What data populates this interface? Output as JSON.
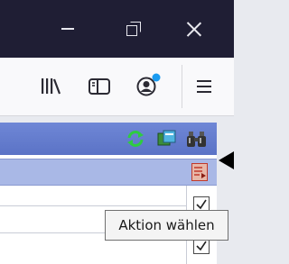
{
  "window_controls": {
    "minimize": "minimize",
    "maximize": "restore",
    "close": "close"
  },
  "toolbar": {
    "icons": [
      "library-icon",
      "sidebar-icon",
      "account-icon",
      "menu-icon"
    ],
    "account_badge_color": "#1a9bf0"
  },
  "panel": {
    "header_color": "#6f87d6",
    "header_icons": [
      "refresh-icon",
      "new-window-icon",
      "binoculars-icon"
    ],
    "action_button_color": "#c0392b",
    "rows": [
      {
        "checked": true
      },
      {
        "checked": true
      }
    ]
  },
  "tooltip": {
    "text": "Aktion wählen"
  }
}
